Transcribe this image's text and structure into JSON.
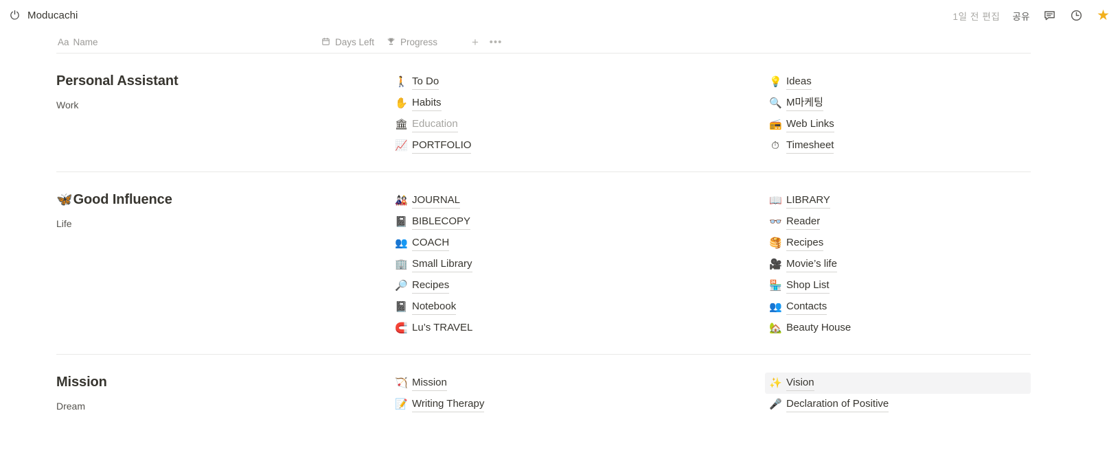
{
  "topbar": {
    "page_emoji": "⏻",
    "page_emoji_name": "power-icon",
    "title": "Moducachi",
    "edited": "1일 전 편집",
    "share": "공유",
    "comment_icon": "comment-icon",
    "history_icon": "clock-icon",
    "favorite_icon": "star-icon",
    "star_color": "#f2b01e"
  },
  "table_head": {
    "aa": "Aa",
    "name": "Name",
    "days_left_icon": "calendar-icon",
    "days_left": "Days Left",
    "progress_icon": "trophy-icon",
    "progress": "Progress",
    "add": "+",
    "more": "•••"
  },
  "rows": [
    {
      "title": "Personal Assistant",
      "title_emoji": "",
      "subtitle": "Work",
      "mid_links": [
        {
          "emoji": "🚶",
          "icon_name": "walking-icon",
          "label": "To Do",
          "muted": false
        },
        {
          "emoji": "✋",
          "icon_name": "hand-icon",
          "label": "Habits",
          "muted": false
        },
        {
          "emoji": "🏛",
          "icon_name": "classical-building-icon",
          "label": "Education",
          "muted": true
        },
        {
          "emoji": "📈",
          "icon_name": "chart-increasing-icon",
          "label": "PORTFOLIO",
          "muted": false
        }
      ],
      "right_links": [
        {
          "emoji": "💡",
          "icon_name": "lightbulb-icon",
          "label": "Ideas",
          "muted": false
        },
        {
          "emoji": "🔍",
          "icon_name": "magnifier-icon",
          "label": "M마케팅",
          "muted": false
        },
        {
          "emoji": "📻",
          "icon_name": "radio-icon",
          "label": "Web Links",
          "muted": false
        },
        {
          "emoji": "⏱",
          "icon_name": "stopwatch-icon",
          "label": "Timesheet",
          "muted": false
        }
      ]
    },
    {
      "title": "Good Influence",
      "title_emoji": "🦋",
      "title_emoji_name": "butterfly-icon",
      "subtitle": "Life",
      "mid_links": [
        {
          "emoji": "🎎",
          "icon_name": "journal-icon",
          "label": "JOURNAL",
          "muted": false
        },
        {
          "emoji": "📓",
          "icon_name": "bible-icon",
          "label": "BIBLECOPY",
          "muted": false
        },
        {
          "emoji": "👥",
          "icon_name": "people-group-icon",
          "label": "COACH",
          "muted": false
        },
        {
          "emoji": "🏢",
          "icon_name": "building-icon",
          "label": "Small Library",
          "muted": false
        },
        {
          "emoji": "🔎",
          "icon_name": "magnifier-tilted-icon",
          "label": "Recipes",
          "muted": false
        },
        {
          "emoji": "📓",
          "icon_name": "notebook-icon",
          "label": "Notebook",
          "muted": false
        },
        {
          "emoji": "🧲",
          "icon_name": "magnet-icon",
          "label": "Lu’s TRAVEL",
          "muted": false
        }
      ],
      "right_links": [
        {
          "emoji": "📖",
          "icon_name": "open-book-icon",
          "label": "LIBRARY",
          "muted": false
        },
        {
          "emoji": "👓",
          "icon_name": "glasses-icon",
          "label": "Reader",
          "muted": false
        },
        {
          "emoji": "🥞",
          "icon_name": "pancakes-icon",
          "label": "Recipes",
          "muted": false
        },
        {
          "emoji": "🎥",
          "icon_name": "movie-camera-icon",
          "label": "Movie’s life",
          "muted": false
        },
        {
          "emoji": "🏪",
          "icon_name": "store-icon",
          "label": "Shop List",
          "muted": false
        },
        {
          "emoji": "👥",
          "icon_name": "two-people-icon",
          "label": "Contacts",
          "muted": false
        },
        {
          "emoji": "🏡",
          "icon_name": "house-garden-icon",
          "label": "Beauty House",
          "muted": false,
          "plain": true
        }
      ]
    },
    {
      "title": "Mission",
      "title_emoji": "",
      "subtitle": "Dream",
      "mid_links": [
        {
          "emoji": "🏹",
          "icon_name": "bow-and-arrow-icon",
          "label": "Mission",
          "muted": false
        },
        {
          "emoji": "📝",
          "icon_name": "memo-icon",
          "label": "Writing Therapy",
          "muted": false
        }
      ],
      "right_links": [
        {
          "emoji": "✨",
          "icon_name": "sparkles-icon",
          "label": "Vision",
          "muted": false,
          "highlight": true
        },
        {
          "emoji": "🎤",
          "icon_name": "microphone-icon",
          "label": "Declaration of Positive",
          "muted": false
        }
      ]
    }
  ]
}
